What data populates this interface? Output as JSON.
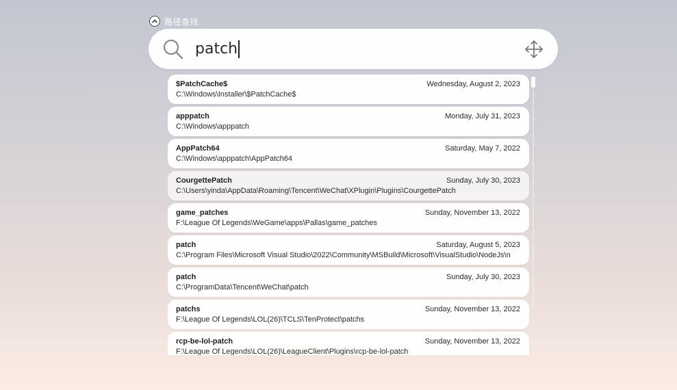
{
  "header": {
    "title": "路径查找",
    "collapse_icon": "chevron-up-icon"
  },
  "search": {
    "query": "patch",
    "search_icon": "search-icon",
    "move_icon": "move-arrows-icon"
  },
  "results": [
    {
      "name": "$PatchCache$",
      "date": "Wednesday, August 2, 2023",
      "path": "C:\\Windows\\Installer\\$PatchCache$"
    },
    {
      "name": "apppatch",
      "date": "Monday, July 31, 2023",
      "path": "C:\\Windows\\apppatch"
    },
    {
      "name": "AppPatch64",
      "date": "Saturday, May 7, 2022",
      "path": "C:\\Windows\\apppatch\\AppPatch64"
    },
    {
      "name": "CourgettePatch",
      "date": "Sunday, July 30, 2023",
      "path": "C:\\Users\\yinda\\AppData\\Roaming\\Tencent\\WeChat\\XPlugin\\Plugins\\CourgettePatch"
    },
    {
      "name": "game_patches",
      "date": "Sunday, November 13, 2022",
      "path": "F:\\League Of Legends\\WeGame\\apps\\Pallas\\game_patches"
    },
    {
      "name": "patch",
      "date": "Saturday, August 5, 2023",
      "path": "C:\\Program Files\\Microsoft Visual Studio\\2022\\Community\\MSBuild\\Microsoft\\VisualStudio\\NodeJs\\n"
    },
    {
      "name": "patch",
      "date": "Sunday, July 30, 2023",
      "path": "C:\\ProgramData\\Tencent\\WeChat\\patch"
    },
    {
      "name": "patchs",
      "date": "Sunday, November 13, 2022",
      "path": "F:\\League Of Legends\\LOL(26)\\TCLS\\TenProtect\\patchs"
    },
    {
      "name": "rcp-be-lol-patch",
      "date": "Sunday, November 13, 2022",
      "path": "F:\\League Of Legends\\LOL(26)\\LeagueClient\\Plugins\\rcp-be-lol-patch"
    }
  ]
}
